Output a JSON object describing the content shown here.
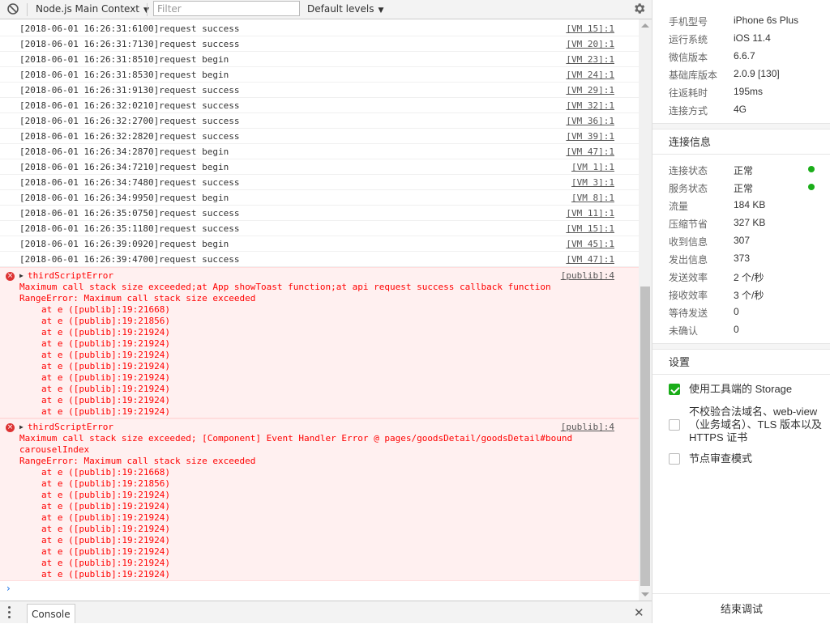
{
  "toolbar": {
    "context": "Node.js Main Context",
    "filter_placeholder": "Filter",
    "levels": "Default levels"
  },
  "logs": [
    {
      "msg": "[2018-06-01 16:26:31:6100]request success",
      "src": "[VM 15]:1"
    },
    {
      "msg": "[2018-06-01 16:26:31:7130]request success",
      "src": "[VM 20]:1"
    },
    {
      "msg": "[2018-06-01 16:26:31:8510]request begin",
      "src": "[VM 23]:1"
    },
    {
      "msg": "[2018-06-01 16:26:31:8530]request begin",
      "src": "[VM 24]:1"
    },
    {
      "msg": "[2018-06-01 16:26:31:9130]request success",
      "src": "[VM 29]:1"
    },
    {
      "msg": "[2018-06-01 16:26:32:0210]request success",
      "src": "[VM 32]:1"
    },
    {
      "msg": "[2018-06-01 16:26:32:2700]request success",
      "src": "[VM 36]:1"
    },
    {
      "msg": "[2018-06-01 16:26:32:2820]request success",
      "src": "[VM 39]:1"
    },
    {
      "msg": "[2018-06-01 16:26:34:2870]request begin",
      "src": "[VM 47]:1"
    },
    {
      "msg": "[2018-06-01 16:26:34:7210]request begin",
      "src": "[VM 1]:1"
    },
    {
      "msg": "[2018-06-01 16:26:34:7480]request success",
      "src": "[VM 3]:1"
    },
    {
      "msg": "[2018-06-01 16:26:34:9950]request begin",
      "src": "[VM 8]:1"
    },
    {
      "msg": "[2018-06-01 16:26:35:0750]request success",
      "src": "[VM 11]:1"
    },
    {
      "msg": "[2018-06-01 16:26:35:1180]request success",
      "src": "[VM 15]:1"
    },
    {
      "msg": "[2018-06-01 16:26:39:0920]request begin",
      "src": "[VM 45]:1"
    },
    {
      "msg": "[2018-06-01 16:26:39:4700]request success",
      "src": "[VM 47]:1"
    }
  ],
  "errors": [
    {
      "title": "thirdScriptError",
      "src": "[publib]:4",
      "lines": [
        "Maximum call stack size exceeded;at App showToast function;at api request success callback function",
        "RangeError: Maximum call stack size exceeded"
      ],
      "stack": [
        "at e ([publib]:19:21668)",
        "at e ([publib]:19:21856)",
        "at e ([publib]:19:21924)",
        "at e ([publib]:19:21924)",
        "at e ([publib]:19:21924)",
        "at e ([publib]:19:21924)",
        "at e ([publib]:19:21924)",
        "at e ([publib]:19:21924)",
        "at e ([publib]:19:21924)",
        "at e ([publib]:19:21924)"
      ]
    },
    {
      "title": "thirdScriptError",
      "src": "[publib]:4",
      "lines": [
        "Maximum call stack size exceeded; [Component] Event Handler Error @ pages/goodsDetail/goodsDetail#bound",
        "carouselIndex",
        "RangeError: Maximum call stack size exceeded"
      ],
      "stack": [
        "at e ([publib]:19:21668)",
        "at e ([publib]:19:21856)",
        "at e ([publib]:19:21924)",
        "at e ([publib]:19:21924)",
        "at e ([publib]:19:21924)",
        "at e ([publib]:19:21924)",
        "at e ([publib]:19:21924)",
        "at e ([publib]:19:21924)",
        "at e ([publib]:19:21924)",
        "at e ([publib]:19:21924)"
      ]
    }
  ],
  "drawer": {
    "tab": "Console"
  },
  "device_info": [
    {
      "k": "手机型号",
      "v": "iPhone 6s Plus"
    },
    {
      "k": "运行系统",
      "v": "iOS 11.4"
    },
    {
      "k": "微信版本",
      "v": "6.6.7"
    },
    {
      "k": "基础库版本",
      "v": "2.0.9 [130]"
    },
    {
      "k": "往返耗时",
      "v": "195ms"
    },
    {
      "k": "连接方式",
      "v": "4G"
    }
  ],
  "connection": {
    "title": "连接信息",
    "items": [
      {
        "k": "连接状态",
        "v": "正常"
      },
      {
        "k": "服务状态",
        "v": "正常"
      },
      {
        "k": "流量",
        "v": "184 KB"
      },
      {
        "k": "压缩节省",
        "v": "327 KB"
      },
      {
        "k": "收到信息",
        "v": "307"
      },
      {
        "k": "发出信息",
        "v": "373"
      },
      {
        "k": "发送效率",
        "v": "2 个/秒"
      },
      {
        "k": "接收效率",
        "v": "3 个/秒"
      },
      {
        "k": "等待发送",
        "v": "0"
      },
      {
        "k": "未确认",
        "v": "0"
      }
    ]
  },
  "settings": {
    "title": "设置",
    "options": [
      {
        "label": "使用工具端的 Storage",
        "checked": true
      },
      {
        "label": "不校验合法域名、web-view（业务域名）、TLS 版本以及 HTTPS 证书",
        "checked": false
      },
      {
        "label": "节点审查模式",
        "checked": false
      }
    ]
  },
  "end_button": "结束调试",
  "colors": {
    "status_green": "#1aad19",
    "error_red": "#ff0000",
    "error_bg": "#fff0f0"
  }
}
